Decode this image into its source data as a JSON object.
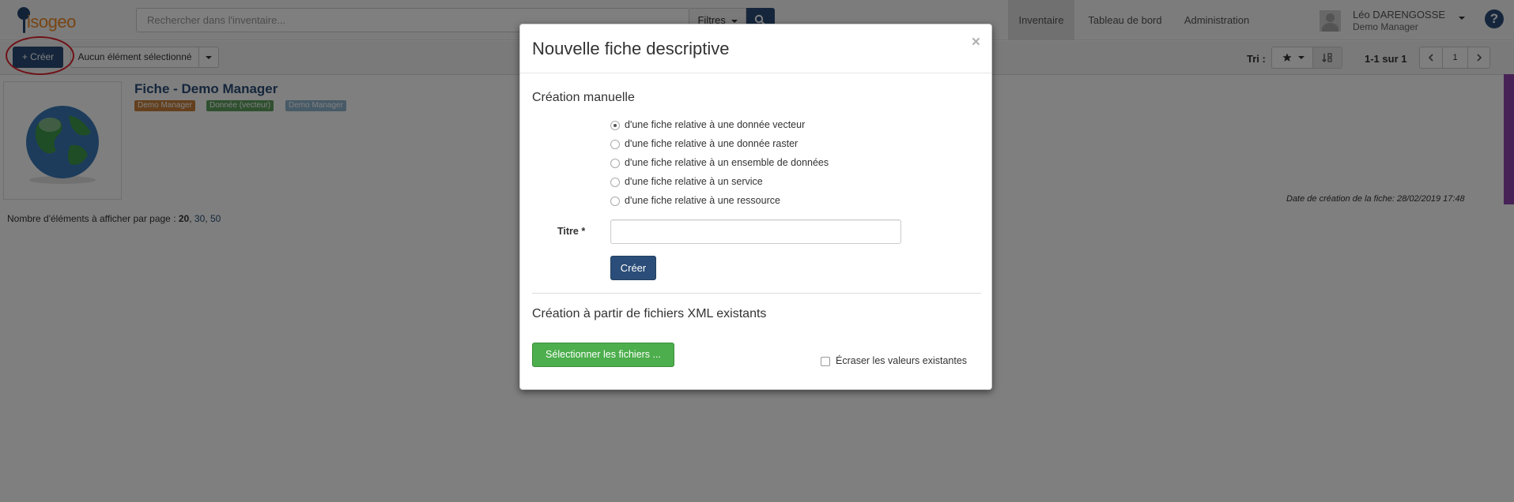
{
  "brand": {
    "name": "isogeo"
  },
  "search": {
    "placeholder": "Rechercher dans l'inventaire...",
    "filters_label": "Filtres"
  },
  "nav": {
    "items": [
      "Inventaire",
      "Tableau de bord",
      "Administration"
    ],
    "active": "Inventaire"
  },
  "user": {
    "name": "Léo DARENGOSSE",
    "org": "Demo Manager"
  },
  "help": {
    "label": "?"
  },
  "toolbar": {
    "create_label": "+ Créer",
    "selection_label": "Aucun élément sélectionné",
    "sort_label": "Tri :",
    "pagination_text": "1-1 sur 1",
    "current_page": "1"
  },
  "result": {
    "title": "Fiche - Demo Manager",
    "tags": [
      {
        "label": "Demo Manager",
        "color": "#c9813c"
      },
      {
        "label": "Donnée (vecteur)",
        "color": "#5fa05f"
      },
      {
        "label": "Demo Manager",
        "color": "#8fb5cf"
      }
    ],
    "created": "Date de création de la fiche: 28/02/2019 17:48"
  },
  "per_page": {
    "label": "Nombre d'éléments à afficher par page :",
    "current": "20",
    "options": [
      "30",
      "50"
    ]
  },
  "modal": {
    "title": "Nouvelle fiche descriptive",
    "close": "×",
    "manual_section": "Création manuelle",
    "options": [
      "d'une fiche relative à une donnée vecteur",
      "d'une fiche relative à une donnée raster",
      "d'une fiche relative à un ensemble de données",
      "d'une fiche relative à un service",
      "d'une fiche relative à une ressource"
    ],
    "selected_option": 0,
    "title_label": "Titre *",
    "title_value": "",
    "create_button": "Créer",
    "xml_section": "Création à partir de fichiers XML existants",
    "select_files_button": "Sélectionner les fichiers ...",
    "overwrite_label": "Écraser les valeurs existantes"
  },
  "colors": {
    "primary": "#2b4d79",
    "success": "#4cae4c",
    "brand_orange": "#f08a24",
    "highlight_circle": "#e0232d",
    "side_bar": "#8e44ad"
  }
}
